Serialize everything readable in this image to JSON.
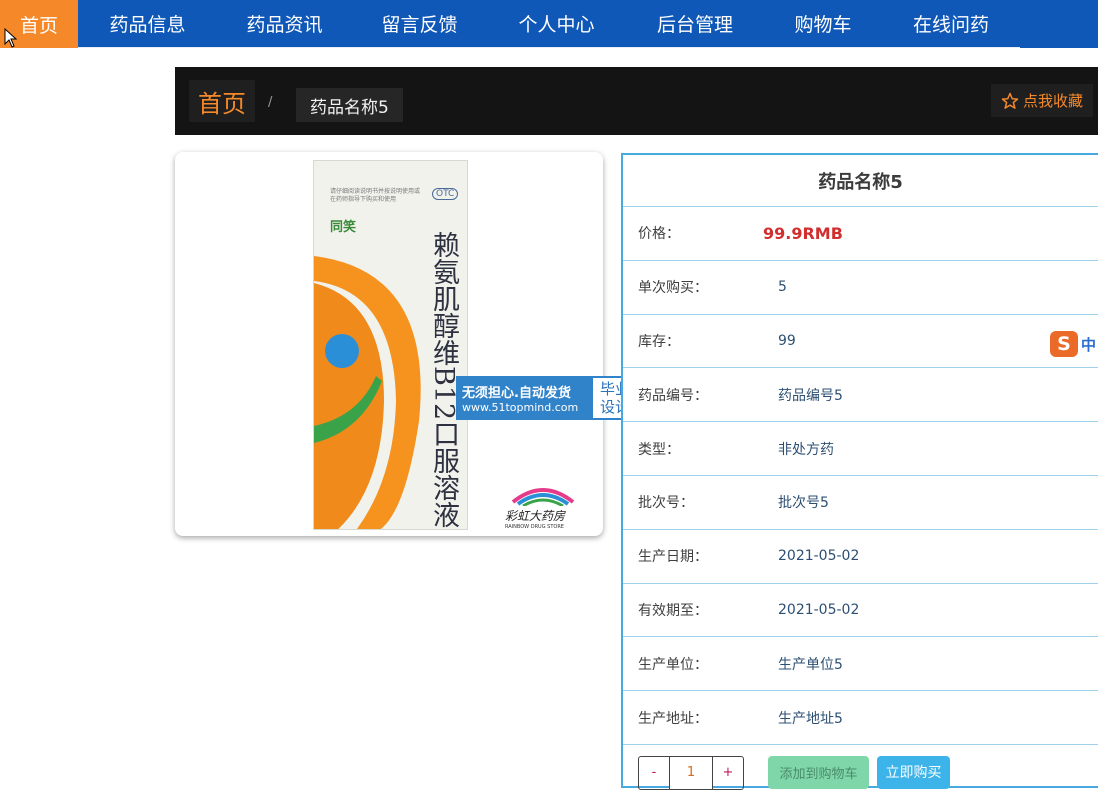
{
  "nav": {
    "items": [
      {
        "label": "首页",
        "width": 78,
        "active": true
      },
      {
        "label": "药品信息",
        "width": 139,
        "active": false
      },
      {
        "label": "药品资讯",
        "width": 135,
        "active": false
      },
      {
        "label": "留言反馈",
        "width": 135,
        "active": false
      },
      {
        "label": "个人中心",
        "width": 139,
        "active": false
      },
      {
        "label": "后台管理",
        "width": 138,
        "active": false
      },
      {
        "label": "购物车",
        "width": 118,
        "active": false
      },
      {
        "label": "在线问药",
        "width": 138,
        "active": false
      }
    ]
  },
  "breadcrumb": {
    "home": "首页",
    "separator": "/",
    "current": "药品名称5",
    "collect_label": "点我收藏"
  },
  "product_image": {
    "box_vertical_text": "赖氨肌醇维B12口服溶液",
    "brand": "同笑",
    "otc": "OTC",
    "small_print": "请仔细阅读说明书并按说明使用或在药师指导下购买和使用",
    "store_name": "彩虹大药房",
    "store_en": "RAINBOW DRUG STORE"
  },
  "watermark": {
    "line1": "无须担心.自动发货",
    "line2": "www.51topmind.com",
    "right": "毕业\n设计",
    "right_top": "毕业",
    "right_bottom": "设计"
  },
  "product": {
    "title": "药品名称5",
    "rows": [
      {
        "label": "价格：",
        "value": "99.9RMB",
        "type": "price"
      },
      {
        "label": "单次购买：",
        "value": "5"
      },
      {
        "label": "库存：",
        "value": "99"
      },
      {
        "label": "药品编号：",
        "value": "药品编号5"
      },
      {
        "label": "类型：",
        "value": "非处方药"
      },
      {
        "label": "批次号：",
        "value": "批次号5"
      },
      {
        "label": "生产日期：",
        "value": "2021-05-02"
      },
      {
        "label": "有效期至：",
        "value": "2021-05-02"
      },
      {
        "label": "生产单位：",
        "value": "生产单位5"
      },
      {
        "label": "生产地址：",
        "value": "生产地址5"
      }
    ]
  },
  "actions": {
    "minus": "-",
    "quantity": "1",
    "plus": "+",
    "add_to_cart": "添加到购物车",
    "buy_now": "立即购买"
  },
  "ime": {
    "logo": "S",
    "lang": "中"
  },
  "colors": {
    "nav_bg": "#0f58b7",
    "nav_active": "#f5892a",
    "panel_border": "#48a9e0",
    "price": "#d12e2e",
    "add_cart": "#7fd6a8",
    "buy_now": "#3cb4ea"
  },
  "icons": {
    "collect": "star-outline-icon",
    "cursor": "mouse-pointer-icon"
  }
}
